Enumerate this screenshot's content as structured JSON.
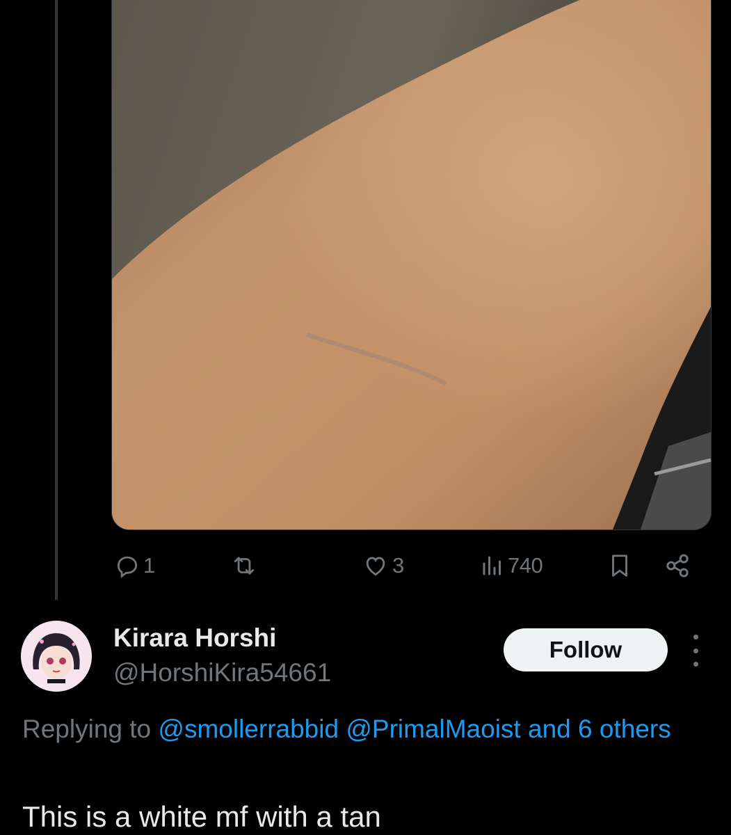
{
  "media": {
    "icon": "photo-of-forearm"
  },
  "actions": {
    "reply_count": "1",
    "retweet_count": "",
    "like_count": "3",
    "views_count": "740"
  },
  "reply": {
    "author_name": "Kirara Horshi",
    "author_handle": "@HorshiKira54661",
    "follow_label": "Follow",
    "replying_prefix": "Replying to",
    "mention_1": "@smollerrabbid",
    "mention_2": "@PrimalMaoist",
    "others_text": "and 6 others",
    "text": "This is a white mf with a tan"
  },
  "colors": {
    "background": "#000000",
    "text_primary": "#e7e9ea",
    "text_secondary": "#71767b",
    "link": "#1d9bf0",
    "follow_bg": "#eff3f4"
  }
}
